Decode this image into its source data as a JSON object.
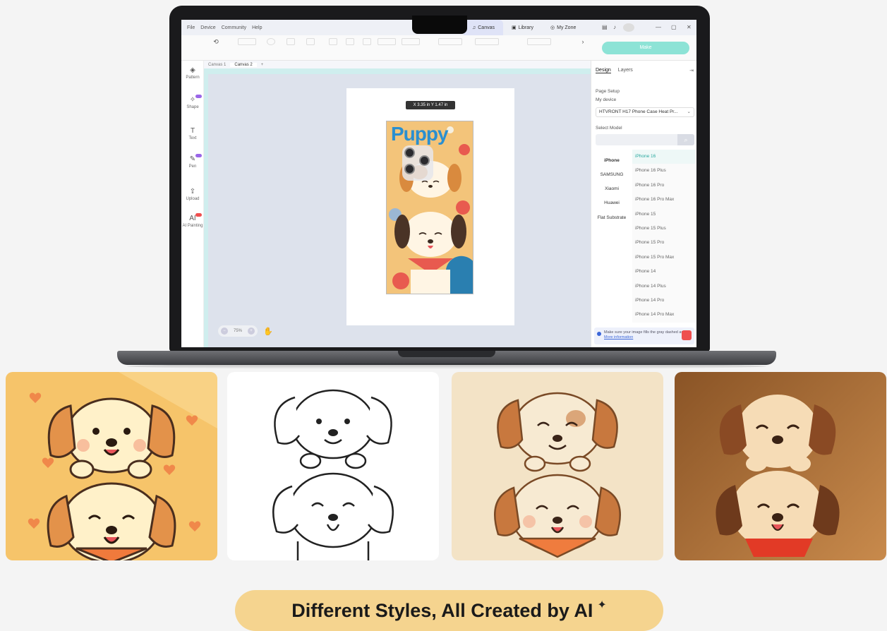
{
  "app": {
    "menu": [
      "File",
      "Device",
      "Community",
      "Help"
    ],
    "tabs": [
      {
        "label": "Canvas",
        "active": true
      },
      {
        "label": "Library",
        "active": false
      },
      {
        "label": "My Zone",
        "active": false
      }
    ],
    "make_label": "Make",
    "sidebar": [
      {
        "label": "Pattern",
        "icon": "pattern-icon"
      },
      {
        "label": "Shape",
        "icon": "shape-icon"
      },
      {
        "label": "Text",
        "icon": "text-icon"
      },
      {
        "label": "Pen",
        "icon": "pen-icon"
      },
      {
        "label": "Upload",
        "icon": "upload-icon"
      },
      {
        "label": "AI Painting",
        "icon": "ai-icon",
        "glyph": "AI"
      }
    ],
    "canvas_tabs": [
      "Canvas 1",
      "Canvas 2"
    ],
    "dimensions": "X 3.35 in  Y 1.47 in",
    "phone_case_text": "Puppy",
    "zoom": "75%",
    "right_panel": {
      "tabs": [
        "Design",
        "Layers"
      ],
      "page_setup": "Page Setup",
      "my_device": "My device",
      "device_value": "HTVRONT H17 Phone Case Heat Pr...",
      "select_model": "Select Model",
      "brands": [
        "iPhone",
        "SAMSUNG",
        "Xiaomi",
        "Huawei",
        "Flat Substrate"
      ],
      "models": [
        "iPhone 16",
        "iPhone 16 Plus",
        "iPhone 16 Pro",
        "iPhone 16 Pro Max",
        "iPhone 15",
        "iPhone 15 Plus",
        "iPhone 15 Pro",
        "iPhone 15 Pro Max",
        "iPhone 14",
        "iPhone 14 Plus",
        "iPhone 14 Pro",
        "iPhone 14 Pro Max"
      ],
      "selected_model": "iPhone 16",
      "note": "Make sure your image fills the gray dashed area.",
      "note_link": "More information"
    }
  },
  "caption": "Different Styles, All Created by AI",
  "colors": {
    "accent": "#8de3d6",
    "caption_bg": "#f5d48f",
    "tile_cartoon": "#f6c46a",
    "tile_line": "#ffffff",
    "tile_sketch": "#f3e3c6",
    "tile_3d": "#b67a3e"
  }
}
